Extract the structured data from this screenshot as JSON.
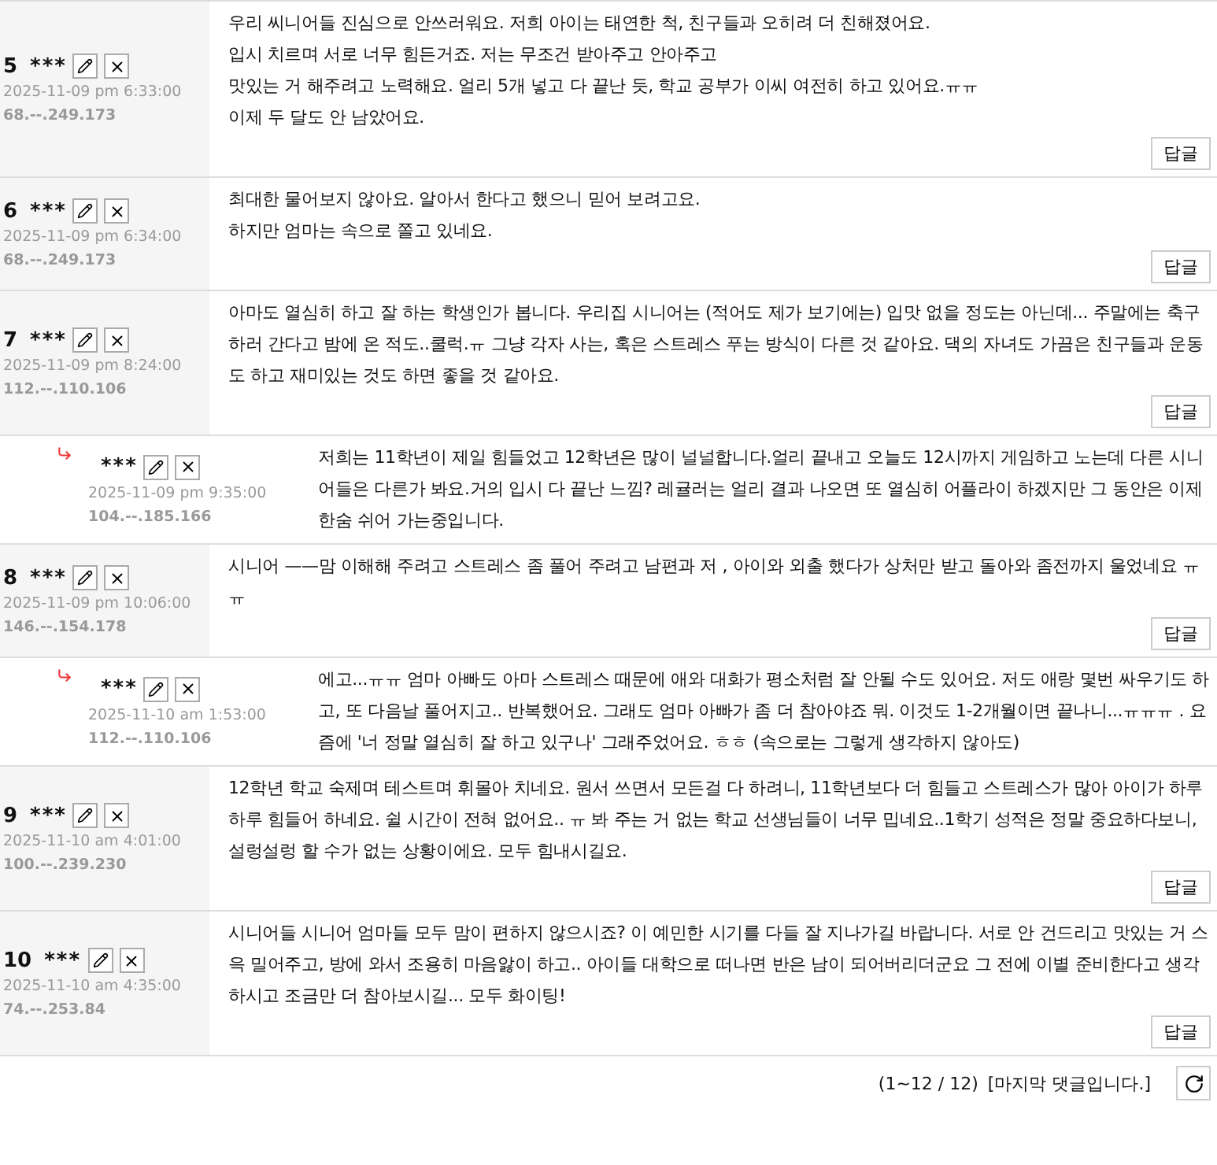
{
  "comments": [
    {
      "kind": "comment",
      "number": "5",
      "author": "***",
      "date": "2025-11-09 pm 6:33:00",
      "ip": "68.--.249.173",
      "paragraphs": [
        "우리 씨니어들 진심으로 안쓰러워요. 저희 아이는 태연한 척, 친구들과 오히려 더 친해졌어요.",
        "입시 치르며 서로 너무 힘든거죠. 저는 무조건 받아주고 안아주고",
        "맛있는 거 해주려고 노력해요. 얼리 5개 넣고 다 끝난 듯, 학교 공부가 이씨 여전히 하고 있어요.ㅠㅠ",
        "이제 두 달도 안 남았어요."
      ],
      "reply_label": "답글"
    },
    {
      "kind": "comment",
      "number": "6",
      "author": "***",
      "date": "2025-11-09 pm 6:34:00",
      "ip": "68.--.249.173",
      "paragraphs": [
        "최대한 물어보지 않아요. 알아서 한다고 했으니 믿어 보려고요.",
        "하지만 엄마는 속으로 쫄고 있네요."
      ],
      "reply_label": "답글"
    },
    {
      "kind": "comment",
      "number": "7",
      "author": "***",
      "date": "2025-11-09 pm 8:24:00",
      "ip": "112.--.110.106",
      "paragraphs": [
        "아마도 열심히 하고 잘 하는 학생인가 봅니다. 우리집 시니어는 (적어도 제가 보기에는) 입맛 없을 정도는 아닌데... 주말에는 축구하러 간다고 밤에 온 적도..쿨럭.ㅠ 그냥 각자 사는, 혹은 스트레스 푸는 방식이 다른 것 같아요. 댁의 자녀도 가끔은 친구들과 운동도 하고 재미있는 것도 하면 좋을 것 같아요."
      ],
      "reply_label": "답글"
    },
    {
      "kind": "reply",
      "author": "***",
      "date": "2025-11-09 pm 9:35:00",
      "ip": "104.--.185.166",
      "paragraphs": [
        "저희는 11학년이 제일 힘들었고 12학년은 많이 널널합니다.얼리 끝내고 오늘도 12시까지 게임하고 노는데 다른 시니어들은 다른가 봐요.거의 입시 다 끝난 느낌? 레귤러는 얼리 결과 나오면 또 열심히 어플라이 하겠지만 그 동안은 이제 한숨 쉬어 가는중입니다."
      ]
    },
    {
      "kind": "comment",
      "number": "8",
      "author": "***",
      "date": "2025-11-09 pm 10:06:00",
      "ip": "146.--.154.178",
      "paragraphs": [
        "시니어 ——맘 이해해 주려고 스트레스 좀 풀어 주려고 남편과 저 , 아이와 외출 했다가 상처만 받고 돌아와 좀전까지 울었네요 ㅠㅠ"
      ],
      "reply_label": "답글"
    },
    {
      "kind": "reply",
      "author": "***",
      "date": "2025-11-10 am 1:53:00",
      "ip": "112.--.110.106",
      "paragraphs": [
        "에고...ㅠㅠ 엄마 아빠도 아마 스트레스 때문에 애와 대화가 평소처럼 잘 안될 수도 있어요. 저도 애랑 몇번 싸우기도 하고, 또 다음날 풀어지고.. 반복했어요. 그래도 엄마 아빠가 좀 더 참아야죠 뭐. 이것도 1-2개월이면 끝나니...ㅠㅠㅠ . 요즘에 '너 정말 열심히 잘 하고 있구나' 그래주었어요. ㅎㅎ (속으로는 그렇게 생각하지 않아도)"
      ]
    },
    {
      "kind": "comment",
      "number": "9",
      "author": "***",
      "date": "2025-11-10 am 4:01:00",
      "ip": "100.--.239.230",
      "paragraphs": [
        "12학년 학교 숙제며 테스트며 휘몰아 치네요. 원서 쓰면서 모든걸 다 하려니, 11학년보다 더 힘들고 스트레스가 많아 아이가 하루하루 힘들어 하네요. 쉴 시간이 전혀 없어요.. ㅠ 봐 주는 거 없는 학교 선생님들이 너무 밉네요..1학기 성적은 정말 중요하다보니, 설렁설렁 할 수가 없는 상황이에요. 모두 힘내시길요."
      ],
      "reply_label": "답글"
    },
    {
      "kind": "comment",
      "number": "10",
      "author": "***",
      "date": "2025-11-10 am 4:35:00",
      "ip": "74.--.253.84",
      "paragraphs": [
        "시니어들 시니어 엄마들 모두 맘이 편하지 않으시죠? 이 예민한 시기를 다들 잘 지나가길 바랍니다. 서로 안 건드리고 맛있는 거 스윽 밀어주고, 방에 와서 조용히 마음앓이 하고.. 아이들 대학으로 떠나면 반은 남이 되어버리더군요 그 전에 이별 준비한다고 생각하시고 조금만 더 참아보시길... 모두 화이팅!"
      ],
      "reply_label": "답글"
    }
  ],
  "footer": {
    "range": "(1~12 / 12)",
    "notice": "[마지막 댓글입니다.]"
  }
}
